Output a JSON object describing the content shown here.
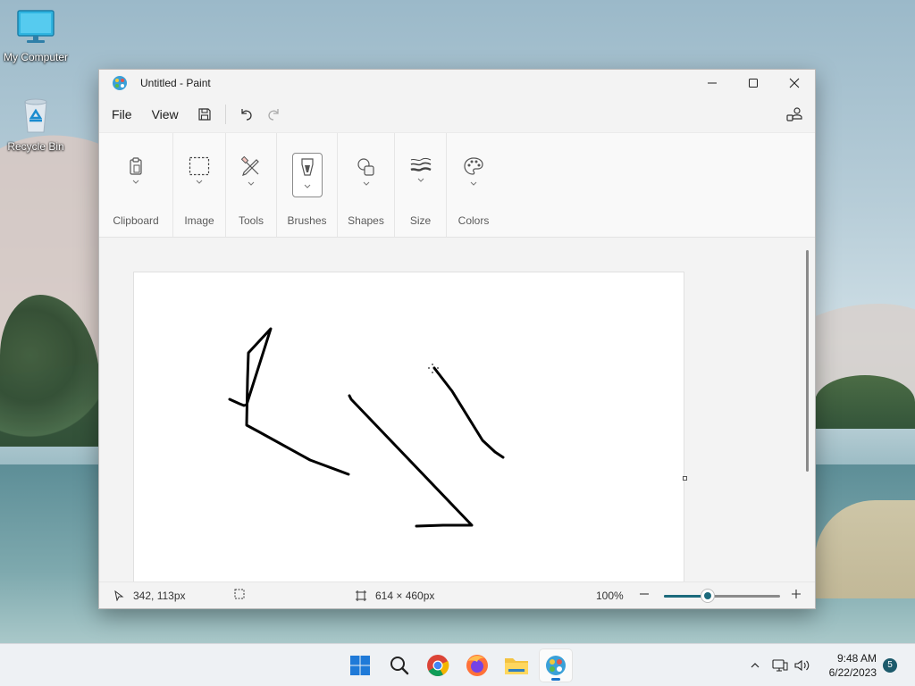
{
  "desktop": {
    "icons": [
      {
        "label": "My Computer",
        "icon": "monitor-icon"
      },
      {
        "label": "Recycle Bin",
        "icon": "recycle-bin-icon"
      }
    ]
  },
  "window": {
    "title": "Untitled - Paint",
    "app_icon": "paint-palette-icon"
  },
  "menubar": {
    "file": "File",
    "view": "View",
    "save_icon": "save-icon",
    "undo_icon": "undo-icon",
    "redo_icon": "redo-icon",
    "share_icon": "account-settings-icon"
  },
  "ribbon": {
    "groups": [
      {
        "label": "Clipboard",
        "icon": "clipboard-icon"
      },
      {
        "label": "Image",
        "icon": "selection-rectangle-icon"
      },
      {
        "label": "Tools",
        "icon": "pencil-eraser-icon"
      },
      {
        "label": "Brushes",
        "icon": "brush-icon",
        "selected": true
      },
      {
        "label": "Shapes",
        "icon": "shapes-icon"
      },
      {
        "label": "Size",
        "icon": "line-width-icon"
      },
      {
        "label": "Colors",
        "icon": "color-palette-icon"
      }
    ]
  },
  "statusbar": {
    "cursor_position": "342, 113px",
    "canvas_size": "614 × 460px",
    "zoom": "100%",
    "zoom_level": 0.38
  },
  "taskbar": {
    "apps": [
      {
        "name": "start-button",
        "icon": "windows-icon"
      },
      {
        "name": "search-button",
        "icon": "search-icon"
      },
      {
        "name": "chrome-button",
        "icon": "chrome-icon"
      },
      {
        "name": "firefox-button",
        "icon": "firefox-icon"
      },
      {
        "name": "file-explorer-button",
        "icon": "folder-icon"
      },
      {
        "name": "paint-button",
        "icon": "paint-palette-icon",
        "active": true
      }
    ],
    "time": "9:48 AM",
    "date": "6/22/2023",
    "notification_count": "5"
  },
  "colors": {
    "accent": "#1c6a7c",
    "taskbar_indicator": "#1a73c8"
  }
}
